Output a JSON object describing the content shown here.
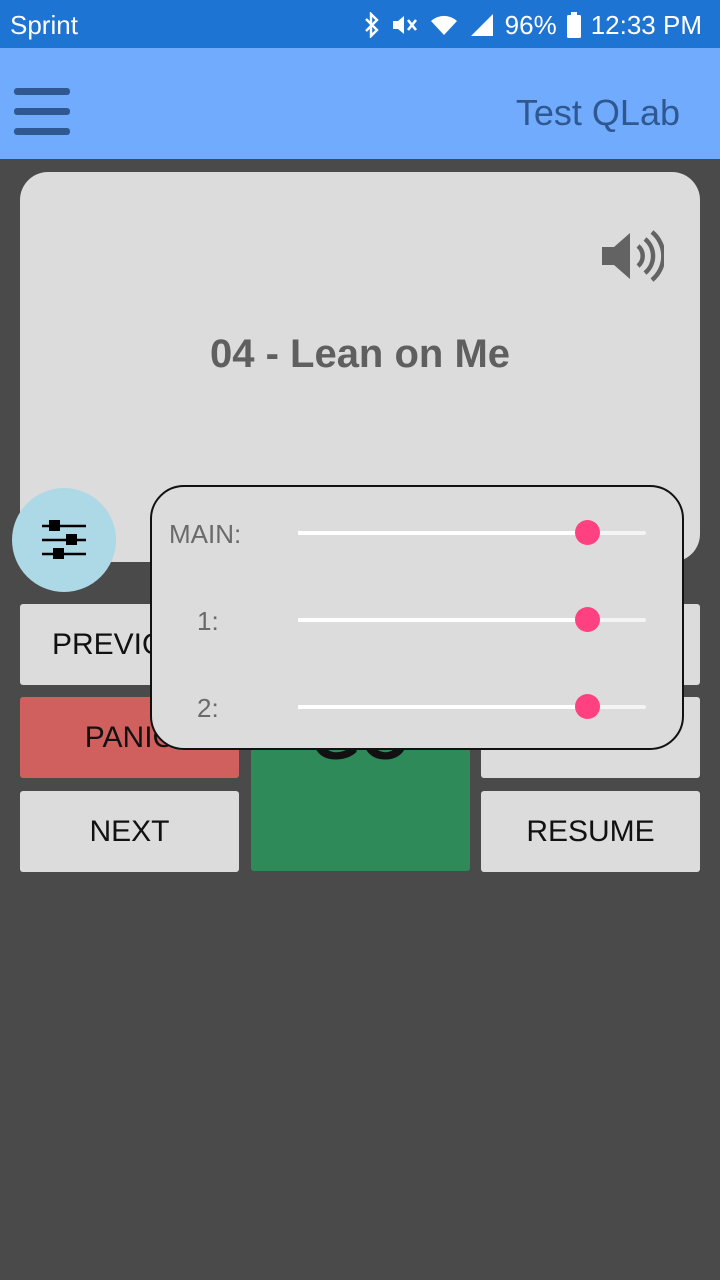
{
  "status_bar": {
    "carrier": "Sprint",
    "battery": "96%",
    "time": "12:33 PM"
  },
  "app_bar": {
    "title": "Test QLab"
  },
  "cue": {
    "title": "04 - Lean on Me",
    "type_icon": "speaker-icon"
  },
  "buttons": {
    "previous": "PREVIOUS",
    "panic": "PANIC",
    "next": "NEXT",
    "resume": "RESUME",
    "go": "GO"
  },
  "volume_popup": {
    "sliders": [
      {
        "label": "MAIN:",
        "level": 0.83
      },
      {
        "label": "1:",
        "level": 0.83
      },
      {
        "label": "2:",
        "level": 0.83
      }
    ]
  },
  "colors": {
    "status_bar": "#1e74d3",
    "app_bar": "#70abfe",
    "panic": "#cf605e",
    "go": "#2e8a59",
    "slider_accent": "#ff4081",
    "fab": "#add8e6"
  }
}
